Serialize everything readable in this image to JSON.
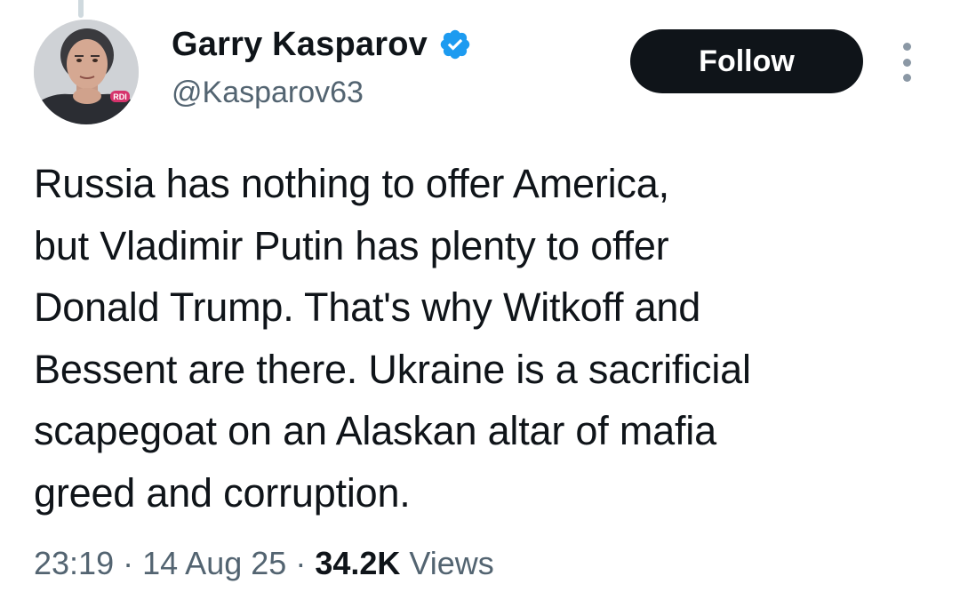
{
  "author": {
    "display_name": "Garry Kasparov",
    "handle": "@Kasparov63",
    "verified": true,
    "avatar_badge": "RDI"
  },
  "actions": {
    "follow_label": "Follow",
    "more_icon": "more-vertical-icon"
  },
  "tweet": {
    "text": "Russia has nothing to offer America,\nbut Vladimir Putin has plenty to offer\nDonald Trump. That's why Witkoff and\nBessent are there. Ukraine is a sacrificial\nscapegoat on an Alaskan altar of mafia\ngreed and corruption."
  },
  "meta": {
    "time": "23:19",
    "separator": "·",
    "date": "14 Aug 25",
    "views_count": "34.2K",
    "views_label": "Views"
  },
  "colors": {
    "verified_blue": "#1d9bf0",
    "button_bg": "#0f1419",
    "secondary_text": "#536471"
  }
}
